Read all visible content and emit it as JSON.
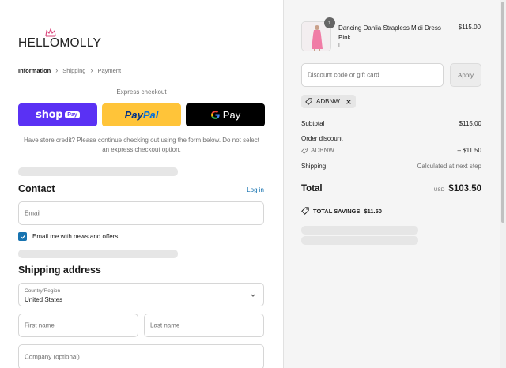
{
  "brand": {
    "name": "HELLOMOLLY"
  },
  "breadcrumb": [
    {
      "label": "Information"
    },
    {
      "label": "Shipping"
    },
    {
      "label": "Payment"
    }
  ],
  "express": {
    "label": "Express checkout",
    "shop_pay": {
      "word": "shop",
      "badge": "Pay"
    },
    "paypal": {
      "pay": "Pay",
      "pal": "Pal"
    },
    "gpay": {
      "label": "Pay"
    }
  },
  "credit_note": "Have store credit? Please continue checking out using the form below. Do not select an express checkout option.",
  "contact": {
    "title": "Contact",
    "login_link": "Log in",
    "email_placeholder": "Email",
    "newsletter_label": "Email me with news and offers",
    "newsletter_checked": true
  },
  "shipping": {
    "title": "Shipping address",
    "country_label": "Country/Region",
    "country_value": "United States",
    "first_name_placeholder": "First name",
    "last_name_placeholder": "Last name",
    "company_placeholder": "Company (optional)"
  },
  "cart": {
    "item": {
      "quantity": "1",
      "name": "Dancing Dahlia Strapless Midi Dress Pink",
      "variant": "L",
      "price": "$115.00"
    },
    "discount_placeholder": "Discount code or gift card",
    "apply_label": "Apply",
    "applied_code": "ADBNW"
  },
  "summary": {
    "subtotal_label": "Subtotal",
    "subtotal_value": "$115.00",
    "order_discount_label": "Order discount",
    "discount_code": "ADBNW",
    "discount_value": "– $11.50",
    "shipping_label": "Shipping",
    "shipping_value": "Calculated at next step",
    "total_label": "Total",
    "currency": "USD",
    "total_value": "$103.50",
    "savings_label": "TOTAL SAVINGS",
    "savings_value": "$11.50"
  },
  "colors": {
    "shop_pay": "#5a31f4",
    "paypal": "#ffc439",
    "gpay": "#000000",
    "link": "#1773b0"
  }
}
